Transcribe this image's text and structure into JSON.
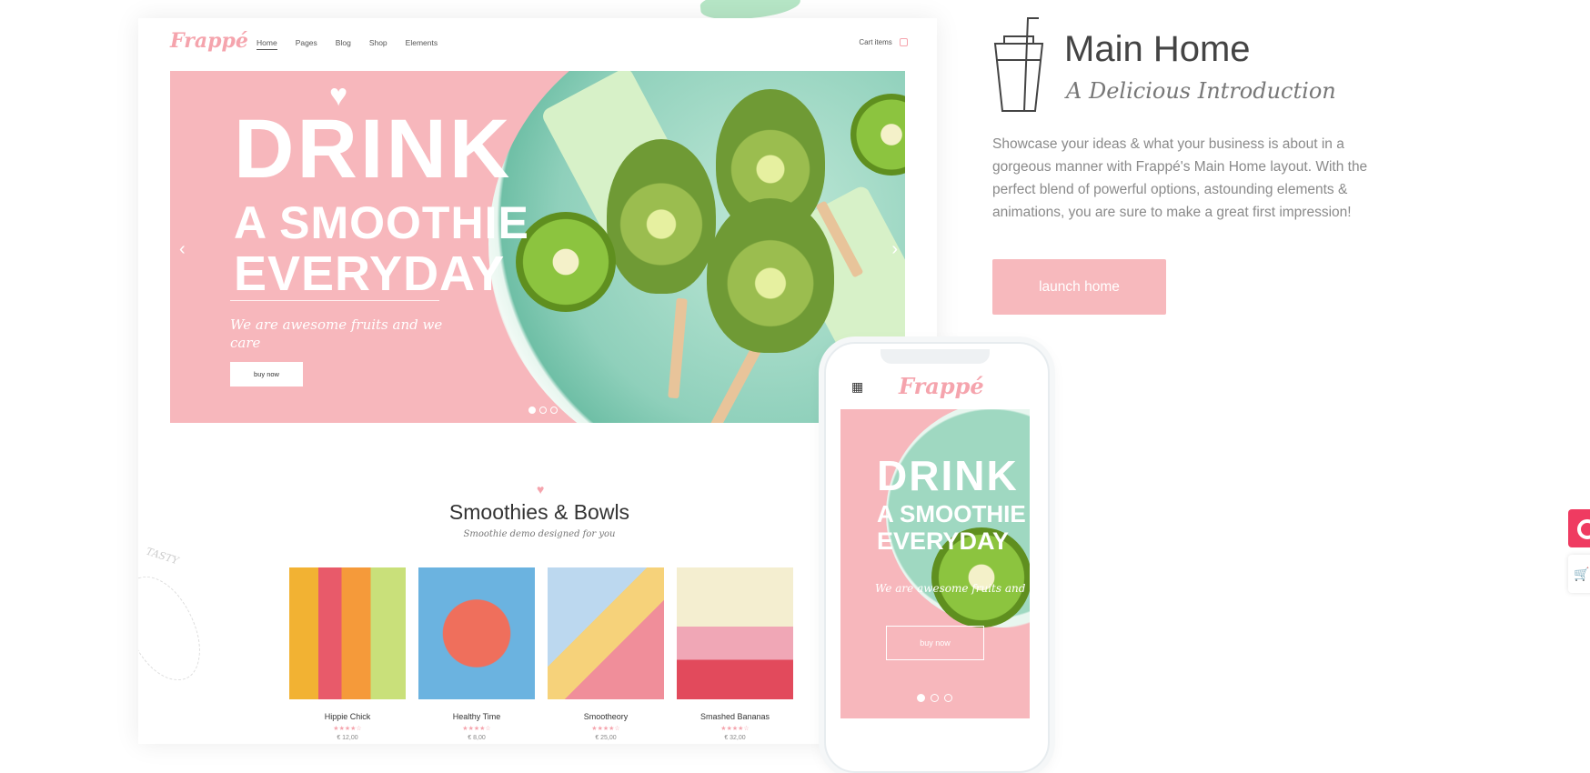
{
  "desktop": {
    "logo": "Frappé",
    "nav": [
      "Home",
      "Pages",
      "Blog",
      "Shop",
      "Elements"
    ],
    "cart_label": "Cart items",
    "hero": {
      "title_line1": "DRINK",
      "title_line2": "A SMOOTHIE",
      "title_line3": "EVERYDAY",
      "subtitle": "We are awesome fruits and we care",
      "button_label": "buy now"
    },
    "section": {
      "title": "Smoothies & Bowls",
      "subtitle": "Smoothie demo designed for you",
      "decoration_text": "TASTY"
    },
    "products": [
      {
        "name": "Hippie Chick",
        "price": "€ 12,00",
        "stars": "★★★★☆"
      },
      {
        "name": "Healthy Time",
        "price": "€ 8,00",
        "stars": "★★★★☆"
      },
      {
        "name": "Smootheory",
        "price": "€ 25,00",
        "stars": "★★★★☆"
      },
      {
        "name": "Smashed Bananas",
        "price": "€ 32,00",
        "stars": "★★★★☆"
      }
    ]
  },
  "phone": {
    "logo": "Frappé",
    "hero": {
      "title_line1": "DRINK",
      "title_line2": "A SMOOTHIE",
      "title_line3": "EVERYDAY",
      "subtitle": "We are awesome fruits and",
      "button_label": "buy now"
    }
  },
  "info": {
    "title": "Main Home",
    "subtitle": "A Delicious Introduction",
    "description": "Showcase your ideas & what your business is about in a gorgeous manner with Frappé's Main Home layout. With the perfect blend of powerful options, astounding elements & animations, you are sure to make a great first impression!",
    "button_label": "launch home"
  },
  "colors": {
    "accent_pink": "#f7b7bc",
    "side_red": "#ef3b61"
  },
  "icons": {
    "cup": "cup-with-straw-icon",
    "menu": "grid-menu-icon",
    "cart": "cart-icon"
  }
}
